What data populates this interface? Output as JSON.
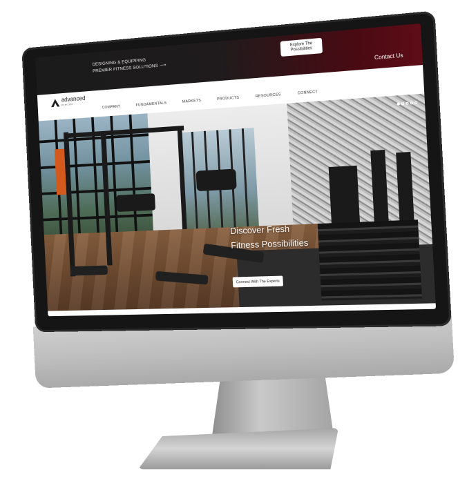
{
  "topbar": {
    "tagline_line1": "DESIGNING & EQUIPPING",
    "tagline_line2": "PREMIER FITNESS SOLUTIONS",
    "tagline_arrow": "⟶",
    "explore_button": "Explore The Possibilities",
    "contact_link": "Contact Us"
  },
  "brand": {
    "name": "advanced",
    "sub": "exercise"
  },
  "nav": {
    "items": [
      "COMPANY",
      "FUNDAMENTALS",
      "MARKETS",
      "PRODUCTS",
      "RESOURCES",
      "CONNECT"
    ]
  },
  "hero": {
    "title_line1": "Discover Fresh",
    "title_line2": "Fitness Possibilities",
    "cta_button": "Connect With The Experts",
    "slides": 5,
    "active_slide": 1
  },
  "colors": {
    "topbar_accent": "#5e0d17",
    "topbar_dark": "#1b1b1b"
  }
}
